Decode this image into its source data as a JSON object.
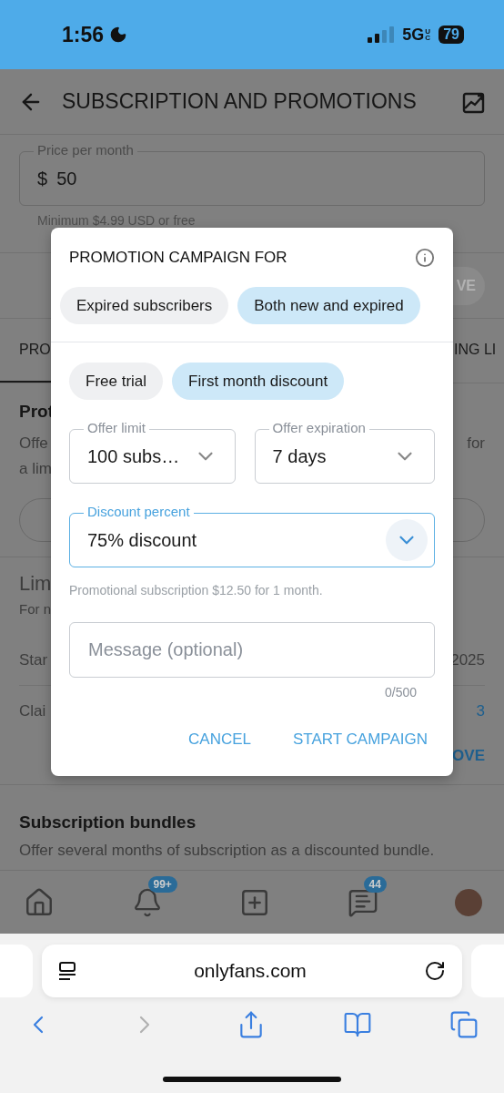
{
  "status_bar": {
    "time": "1:56",
    "network": "5G",
    "network_suffix": "UC",
    "battery": "79"
  },
  "header": {
    "title": "SUBSCRIPTION AND PROMOTIONS"
  },
  "price_field": {
    "label": "Price per month",
    "currency": "$",
    "value": "50",
    "hint": "Minimum $4.99 USD or free"
  },
  "save_button": {
    "label": "VE"
  },
  "tabs": [
    {
      "label": "PRO",
      "selected": true
    },
    {
      "label": "ING LI",
      "selected": false
    }
  ],
  "promotions_section": {
    "title": "Prot",
    "lines": [
      {
        "left": "Offe",
        "right": "for"
      },
      {
        "left": "a lim"
      }
    ]
  },
  "limited_section": {
    "title": "Lim",
    "subtitle": "For n",
    "rows": [
      {
        "label": "Star",
        "value": "2025",
        "kind": "text"
      },
      {
        "label": "Clai",
        "value": "3",
        "kind": "link"
      }
    ],
    "action": "OVE"
  },
  "bundles": {
    "title": "Subscription bundles",
    "description": "Offer several months of subscription as a discounted bundle."
  },
  "bottom_nav": [
    {
      "kind": "home"
    },
    {
      "kind": "bell",
      "badge": "99+"
    },
    {
      "kind": "add"
    },
    {
      "kind": "chat",
      "badge": "44"
    },
    {
      "kind": "avatar"
    }
  ],
  "dialog": {
    "title": "PROMOTION CAMPAIGN FOR",
    "audience": [
      {
        "label": "Expired subscribers",
        "selected": false
      },
      {
        "label": "Both new and expired",
        "selected": true
      }
    ],
    "offer_type": [
      {
        "label": "Free trial",
        "selected": false
      },
      {
        "label": "First month discount",
        "selected": true
      }
    ],
    "offer_limit": {
      "label": "Offer limit",
      "value": "100 subs…"
    },
    "offer_expiration": {
      "label": "Offer expiration",
      "value": "7 days"
    },
    "discount": {
      "label": "Discount percent",
      "value": "75% discount",
      "focused": true
    },
    "note": "Promotional subscription $12.50 for 1 month.",
    "message": {
      "placeholder": "Message (optional)",
      "counter": "0/500"
    },
    "buttons": [
      {
        "label": "CANCEL"
      },
      {
        "label": "START CAMPAIGN"
      }
    ]
  },
  "browser": {
    "url": "onlyfans.com",
    "toolbar": [
      {
        "kind": "back",
        "disabled": false
      },
      {
        "kind": "forward",
        "disabled": true
      },
      {
        "kind": "share",
        "disabled": false
      },
      {
        "kind": "bookmarks",
        "disabled": false
      },
      {
        "kind": "tabs",
        "disabled": false
      }
    ]
  }
}
